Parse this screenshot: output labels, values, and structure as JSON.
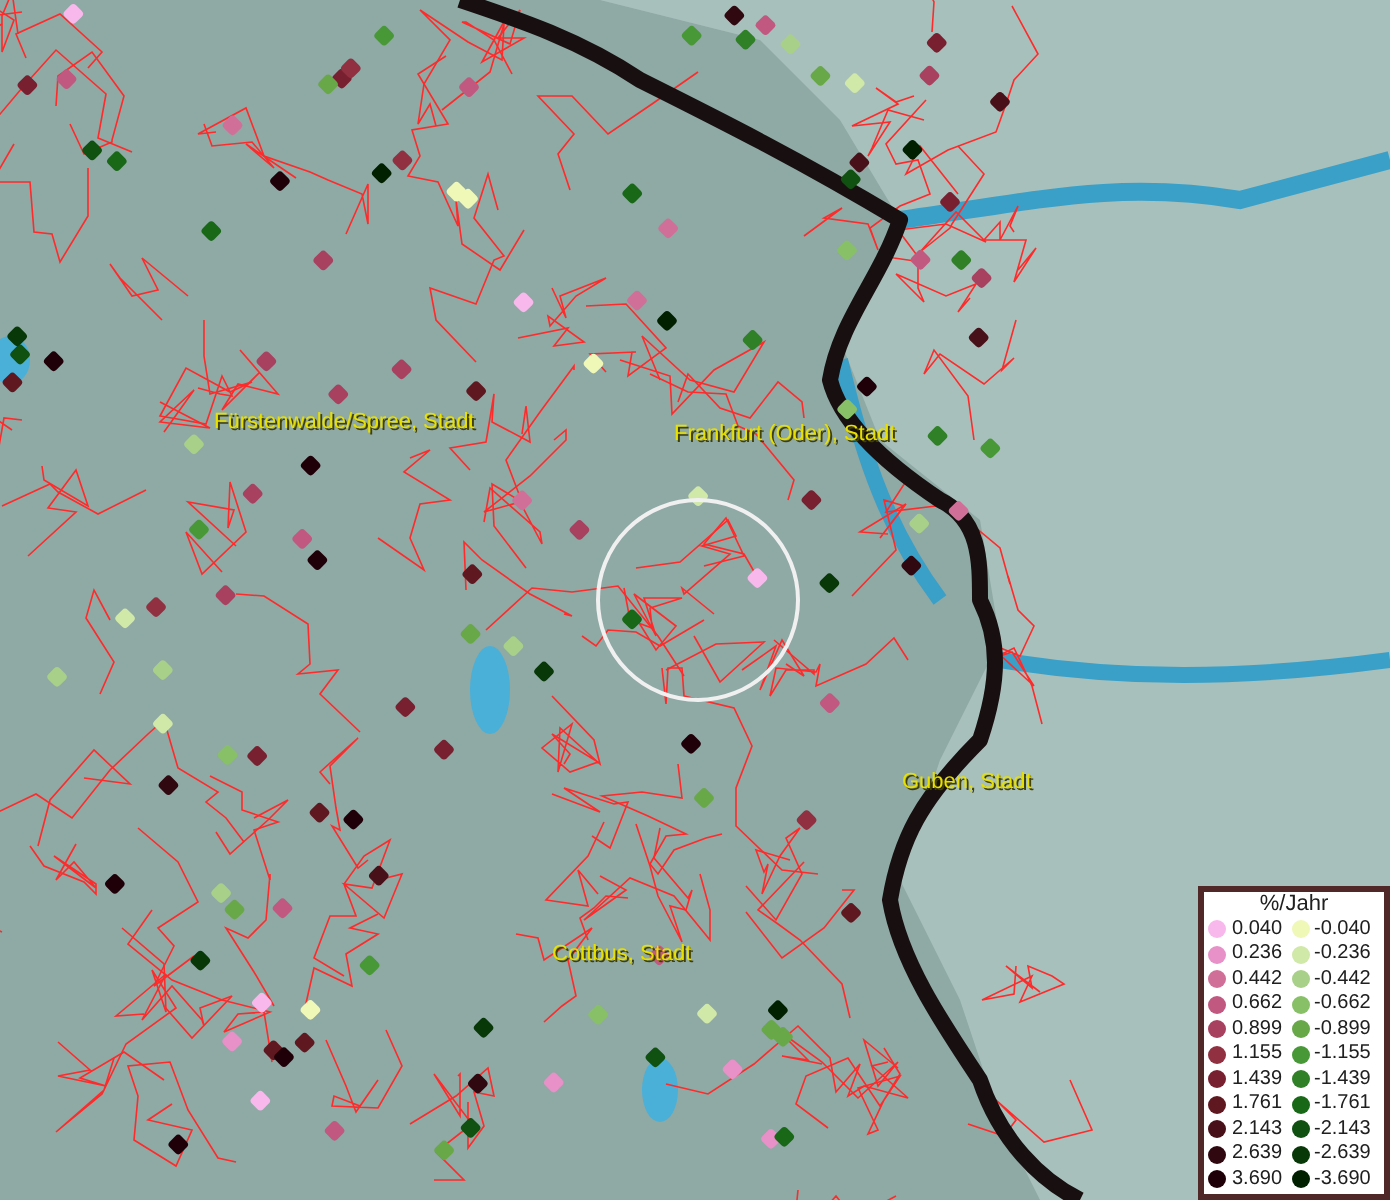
{
  "map": {
    "labels": [
      {
        "text": "Fürstenwalde/Spree, Stadt"
      },
      {
        "text": "Frankfurt (Oder), Stadt"
      },
      {
        "text": "Guben, Stadt"
      },
      {
        "text": "Cottbus, Stadt"
      }
    ]
  },
  "legend": {
    "title": "%/Jahr",
    "rows": [
      {
        "positive": {
          "value": "0.040",
          "color": "#f8b8ec"
        },
        "negative": {
          "value": "-0.040",
          "color": "#f0f8b8"
        }
      },
      {
        "positive": {
          "value": "0.236",
          "color": "#e890c8"
        },
        "negative": {
          "value": "-0.236",
          "color": "#d0e8a8"
        }
      },
      {
        "positive": {
          "value": "0.442",
          "color": "#d07098"
        },
        "negative": {
          "value": "-0.442",
          "color": "#a8d088"
        }
      },
      {
        "positive": {
          "value": "0.662",
          "color": "#c05880"
        },
        "negative": {
          "value": "-0.662",
          "color": "#88c068"
        }
      },
      {
        "positive": {
          "value": "0.899",
          "color": "#a84060"
        },
        "negative": {
          "value": "-0.899",
          "color": "#68a848"
        }
      },
      {
        "positive": {
          "value": "1.155",
          "color": "#903040"
        },
        "negative": {
          "value": "-1.155",
          "color": "#489838"
        }
      },
      {
        "positive": {
          "value": "1.439",
          "color": "#782030"
        },
        "negative": {
          "value": "-1.439",
          "color": "#308028"
        }
      },
      {
        "positive": {
          "value": "1.761",
          "color": "#601820"
        },
        "negative": {
          "value": "-1.761",
          "color": "#186818"
        }
      },
      {
        "positive": {
          "value": "2.143",
          "color": "#481018"
        },
        "negative": {
          "value": "-2.143",
          "color": "#105010"
        }
      },
      {
        "positive": {
          "value": "2.639",
          "color": "#300810"
        },
        "negative": {
          "value": "-2.639",
          "color": "#083808"
        }
      },
      {
        "positive": {
          "value": "3.690",
          "color": "#200008"
        },
        "negative": {
          "value": "-3.690",
          "color": "#002000"
        }
      }
    ]
  }
}
